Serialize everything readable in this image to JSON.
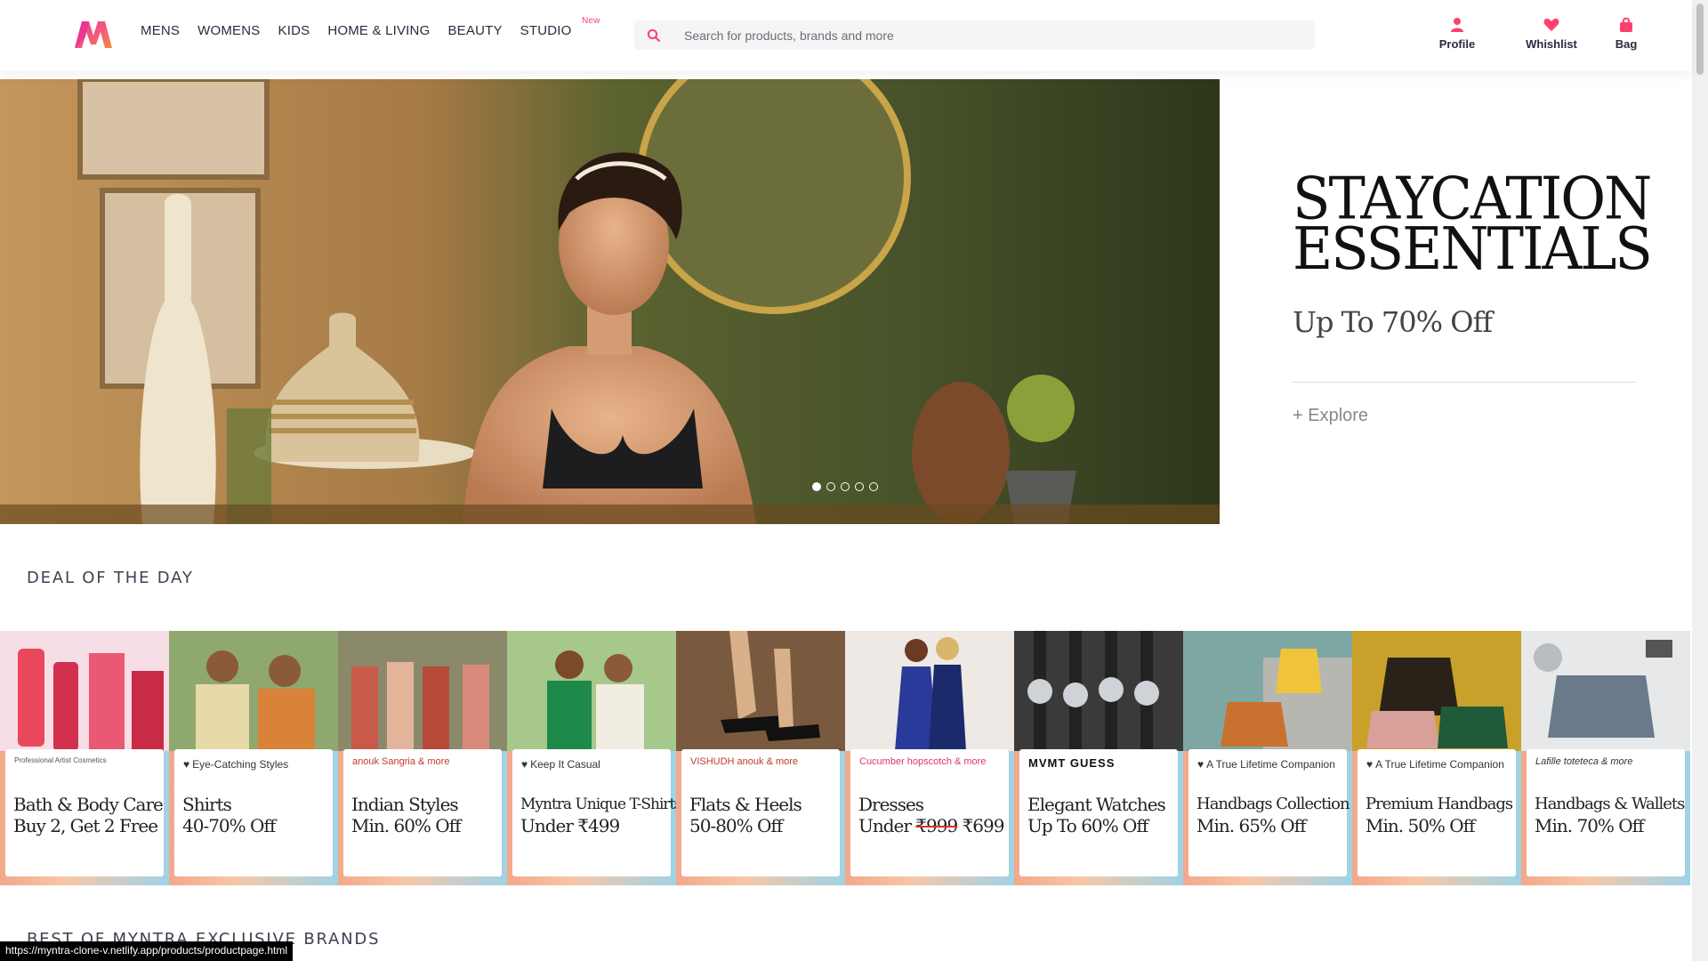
{
  "header": {
    "logo_icon": "myntra-logo-icon",
    "nav": [
      {
        "label": "MENS"
      },
      {
        "label": "WOMENS"
      },
      {
        "label": "KIDS"
      },
      {
        "label": "HOME & LIVING"
      },
      {
        "label": "BEAUTY"
      },
      {
        "label": "STUDIO",
        "badge": "New"
      }
    ],
    "search": {
      "placeholder": "Search for products, brands and more",
      "value": ""
    },
    "actions": [
      {
        "label": "Profile",
        "icon": "user-icon"
      },
      {
        "label": "Whishlist",
        "icon": "heart-icon"
      },
      {
        "label": "Bag",
        "icon": "bag-icon"
      }
    ],
    "accent_color": "#ff3f6c"
  },
  "hero": {
    "title_line1": "STAYCATION",
    "title_line2": "ESSENTIALS",
    "subtitle": "Up To 70% Off",
    "explore": "+ Explore",
    "slides_total": 5,
    "active_slide": 1
  },
  "deal_section": {
    "title": "DEAL OF THE DAY",
    "items": [
      {
        "tag": "",
        "brands": "Professional Artist Cosmetics",
        "line1": "Bath & Body Care",
        "line2": "Buy 2, Get 2 Free"
      },
      {
        "tag": "Eye-Catching Styles",
        "brands": "",
        "line1": "Shirts",
        "line2": "40-70% Off"
      },
      {
        "tag": "",
        "brands": "anouk   Sangria   & more",
        "line1": "Indian Styles",
        "line2": "Min. 60% Off"
      },
      {
        "tag": "Keep It Casual",
        "brands": "",
        "line1": "Myntra Unique T-Shirts",
        "line2": "Under ₹499"
      },
      {
        "tag": "",
        "brands": "VISHUDH   anouk   & more",
        "line1": "Flats & Heels",
        "line2": "50-80% Off"
      },
      {
        "tag": "",
        "brands": "Cucumber   hopscotch   & more",
        "line1": "Dresses",
        "line2_prefix": "Under ",
        "line2_strike": "₹999",
        "line2_suffix": " ₹699"
      },
      {
        "tag": "",
        "brands": "MVMT   GUESS",
        "line1": "Elegant Watches",
        "line2": "Up To 60% Off"
      },
      {
        "tag": "A True Lifetime Companion",
        "brands": "",
        "line1": "Handbags Collection",
        "line2": "Min. 65% Off"
      },
      {
        "tag": "A True Lifetime Companion",
        "brands": "",
        "line1": "Premium Handbags",
        "line2": "Min. 50% Off"
      },
      {
        "tag": "",
        "brands": "Lafille   toteteca   & more",
        "line1": "Handbags & Wallets",
        "line2": "Min. 70% Off"
      }
    ]
  },
  "brands_section": {
    "title": "BEST OF MYNTRA EXCLUSIVE BRANDS"
  },
  "status_bar": {
    "url": "https://myntra-clone-v.netlify.app/products/productpage.html"
  }
}
